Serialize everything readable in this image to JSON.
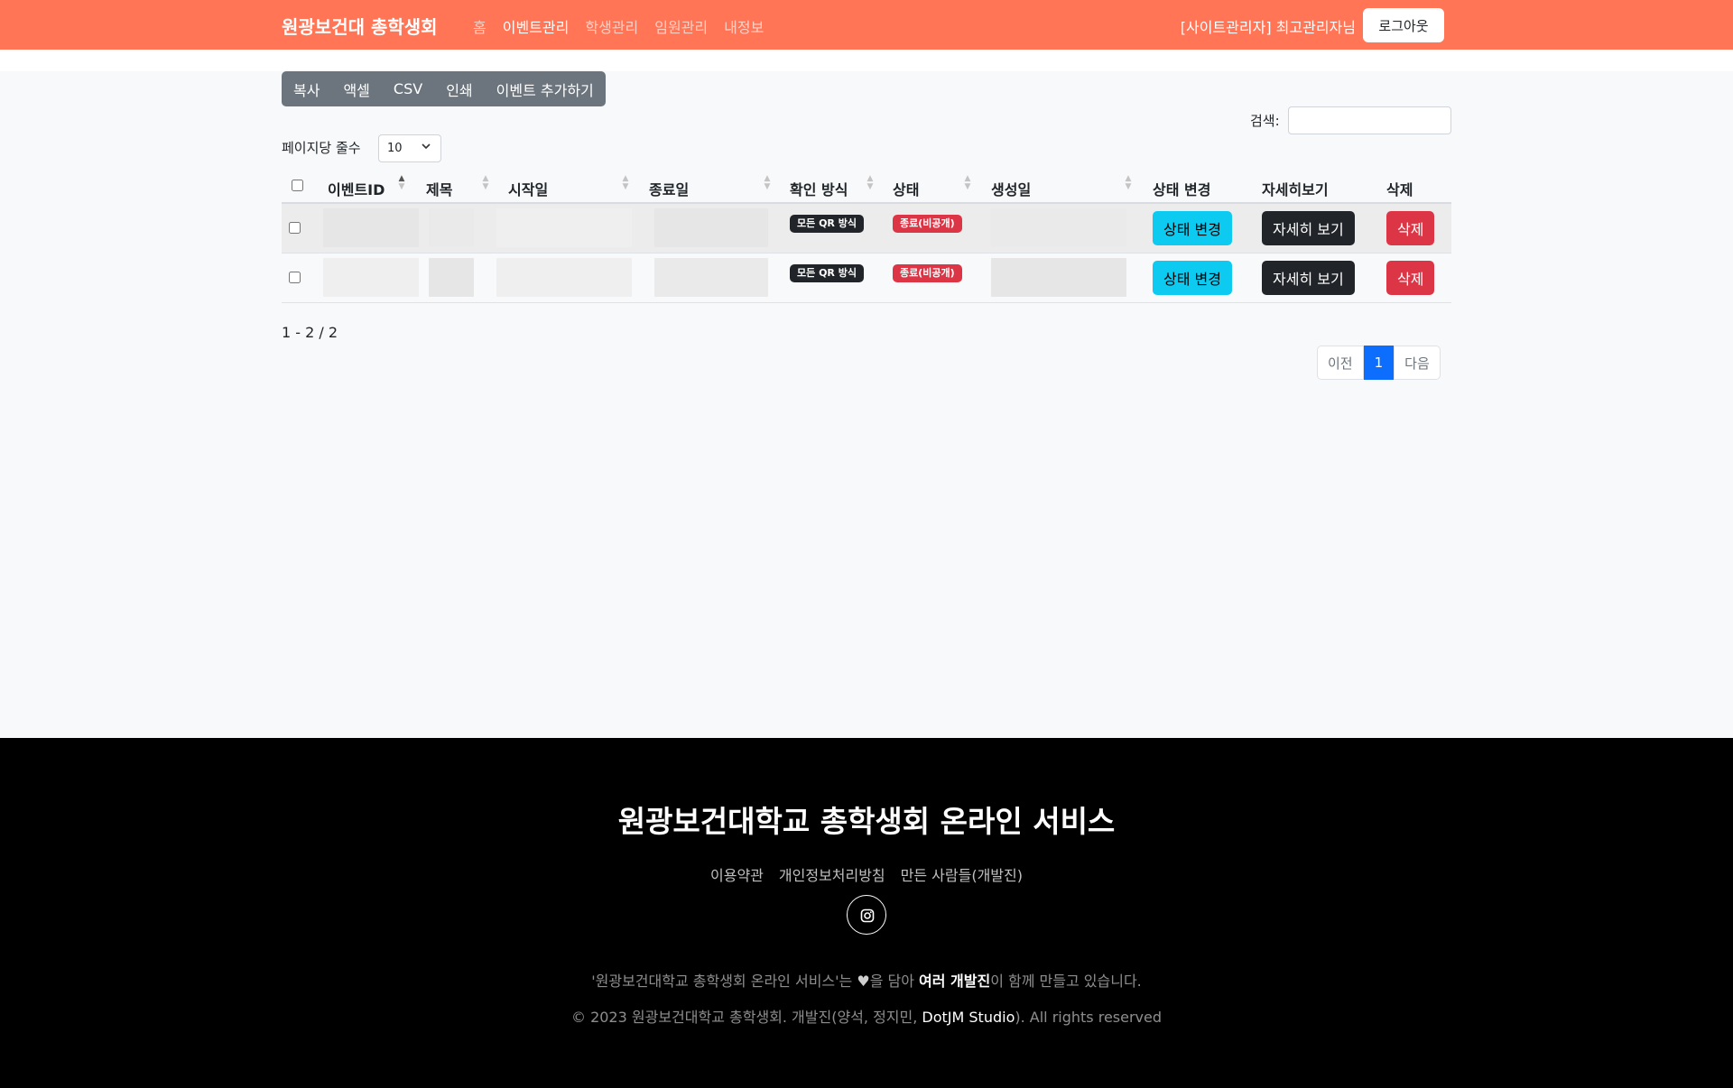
{
  "navbar": {
    "brand": "원광보건대 총학생회",
    "links": [
      {
        "label": "홈",
        "active": false
      },
      {
        "label": "이벤트관리",
        "active": true
      },
      {
        "label": "학생관리",
        "active": false
      },
      {
        "label": "임원관리",
        "active": false
      },
      {
        "label": "내정보",
        "active": false
      }
    ],
    "user_label": "[사이트관리자] 최고관리자님",
    "logout_label": "로그아웃",
    "bg_color": "#ff7556"
  },
  "toolbar": {
    "buttons": [
      "복사",
      "액셀",
      "CSV",
      "인쇄",
      "이벤트 추가하기"
    ]
  },
  "search": {
    "label": "검색:",
    "value": ""
  },
  "page_length": {
    "label": "페이지당 줄수",
    "value": "10"
  },
  "table": {
    "columns": [
      "이벤트ID",
      "제목",
      "시작일",
      "종료일",
      "확인 방식",
      "상태",
      "생성일",
      "상태 변경",
      "자세히보기",
      "삭제"
    ],
    "sorted_column": "이벤트ID",
    "rows": [
      {
        "method": "모든 QR 방식",
        "status": "종료(비공개)",
        "change": "상태 변경",
        "detail": "자세히 보기",
        "delete": "삭제"
      },
      {
        "method": "모든 QR 방식",
        "status": "종료(비공개)",
        "change": "상태 변경",
        "detail": "자세히 보기",
        "delete": "삭제"
      }
    ]
  },
  "info": "1 - 2 / 2",
  "pagination": {
    "prev": "이전",
    "current": "1",
    "next": "다음"
  },
  "footer": {
    "title": "원광보건대학교 총학생회 온라인 서비스",
    "links": [
      "이용약관",
      "개인정보처리방침",
      "만든 사람들(개발진)"
    ],
    "social_icon": "instagram-icon",
    "made_prefix": "'원광보건대학교 총학생회 온라인 서비스'는 ",
    "made_heart": "♥",
    "made_mid": "을 담아 ",
    "made_strong": "여러 개발진",
    "made_suffix": "이 함께 만들고 있습니다.",
    "copy_prefix": "© 2023 원광보건대학교 총학생회. 개발진(양석, 정지민, ",
    "copy_strong": "DotJM Studio",
    "copy_suffix": "). All rights reserved"
  }
}
